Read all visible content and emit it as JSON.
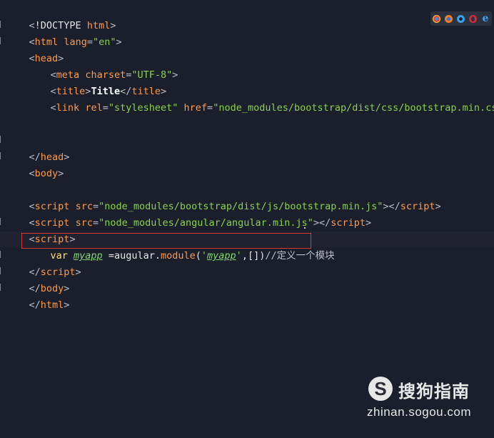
{
  "editor": {
    "lines": {
      "doctype": {
        "lt": "<",
        "text": "!DOCTYPE ",
        "name": "html",
        "gt": ">"
      },
      "html_open": {
        "lt": "<",
        "tag": "html",
        "sp": " ",
        "attr": "lang",
        "eq": "=",
        "val": "\"en\"",
        "gt": ">"
      },
      "head_open": {
        "lt": "<",
        "tag": "head",
        "gt": ">"
      },
      "meta": {
        "lt": "<",
        "tag": "meta",
        "sp": " ",
        "attr": "charset",
        "eq": "=",
        "val": "\"UTF-8\"",
        "gt": ">"
      },
      "title": {
        "lt": "<",
        "tag": "title",
        "gt": ">",
        "content": "Title",
        "close_lt": "</",
        "close_tag": "title",
        "close_gt": ">"
      },
      "link": {
        "lt": "<",
        "tag": "link",
        "sp": " ",
        "attr1": "rel",
        "eq1": "=",
        "val1": "\"stylesheet\"",
        "sp2": " ",
        "attr2": "href",
        "eq2": "=",
        "val2": "\"node_modules/bootstrap/dist/css/bootstrap.min.css\"",
        "gt": ">"
      },
      "head_close": {
        "lt": "</",
        "tag": "head",
        "gt": ">"
      },
      "body_open": {
        "lt": "<",
        "tag": "body",
        "gt": ">"
      },
      "script1": {
        "lt": "<",
        "tag": "script",
        "sp": " ",
        "attr": "src",
        "eq": "=",
        "val": "\"node_modules/bootstrap/dist/js/bootstrap.min.js\"",
        "gt": ">",
        "close_lt": "</",
        "close_tag": "script",
        "close_gt": ">"
      },
      "script2": {
        "lt": "<",
        "tag": "script",
        "sp": " ",
        "attr": "src",
        "eq": "=",
        "val": "\"node_modules/angular/angular.min.js\"",
        "gt": ">",
        "close_lt": "</",
        "close_tag": "script",
        "close_gt": ">"
      },
      "script3_open": {
        "lt": "<",
        "tag": "script",
        "gt": ">"
      },
      "code": {
        "kw": "var",
        "sp": " ",
        "var": "myapp",
        "assign": " =augular.",
        "fn": "module",
        "p1": "(",
        "q1": "'",
        "str": "myapp",
        "q2": "'",
        "rest": ",[])",
        "comment": "//定义一个模块"
      },
      "script3_close": {
        "lt": "</",
        "tag": "script",
        "gt": ">"
      },
      "body_close": {
        "lt": "</",
        "tag": "body",
        "gt": ">"
      },
      "html_close": {
        "lt": "</",
        "tag": "html",
        "gt": ">"
      }
    }
  },
  "browser_icons": [
    "chrome-icon",
    "firefox-icon",
    "ie-icon",
    "opera-icon",
    "edge-icon"
  ],
  "browser_icon_e": "e",
  "watermark": {
    "logo": "S",
    "title": "搜狗指南",
    "url": "zhinan.sogou.com"
  },
  "colors": {
    "background": "#1b1e2b",
    "tag": "#ff9a48",
    "string": "#8bd04f",
    "keyword": "#ffe16e",
    "highlight_box": "#d63b3b"
  }
}
